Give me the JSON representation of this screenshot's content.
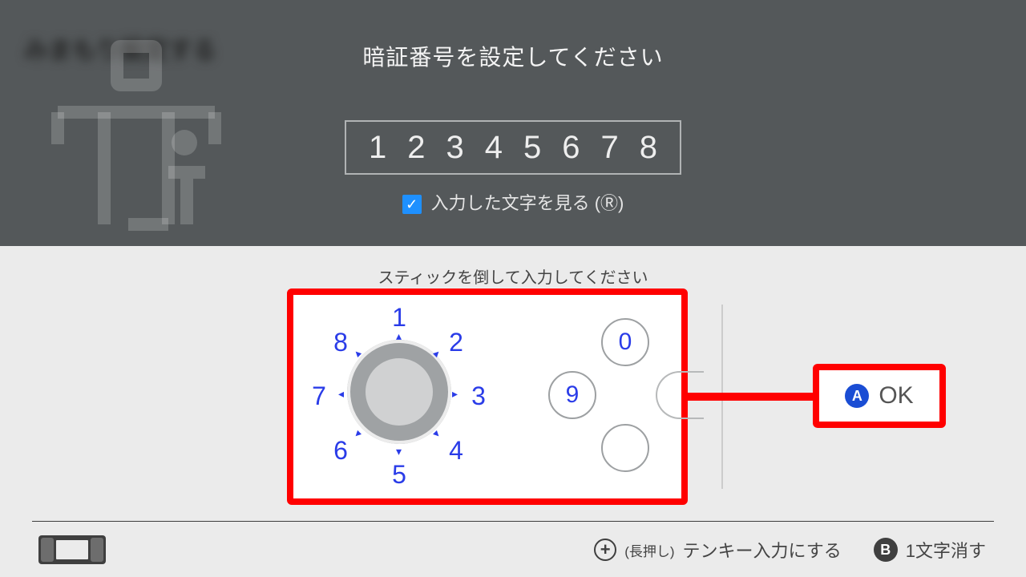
{
  "header": {
    "blurred_text": "みまもり設定する",
    "title": "暗証番号を設定してください",
    "pin_value": "12345678",
    "show_chars_label": "入力した文字を見る (Ⓡ)",
    "show_chars_checked": true
  },
  "instruction": "スティックを倒して入力してください",
  "dial": {
    "numbers": [
      "1",
      "2",
      "3",
      "4",
      "5",
      "6",
      "7",
      "8"
    ],
    "face_buttons": {
      "x": "0",
      "y": "9"
    }
  },
  "ok_button": {
    "glyph": "A",
    "label": "OK"
  },
  "footer": {
    "plus_hint_prefix": "(長押し)",
    "plus_hint_label": "テンキー入力にする",
    "b_glyph": "B",
    "b_label": "1文字消す"
  }
}
